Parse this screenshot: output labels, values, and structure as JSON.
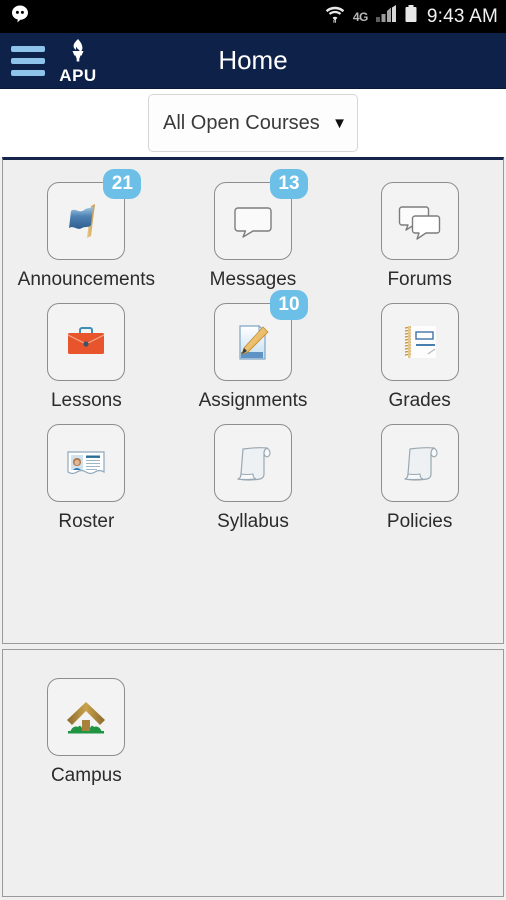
{
  "status_bar": {
    "notification_icon": "hangouts-icon",
    "wifi_icon": "wifi-icon",
    "network_label": "4G",
    "signal_icon": "signal-bars-icon",
    "battery_icon": "battery-icon",
    "time": "9:43 AM"
  },
  "header": {
    "menu_icon": "hamburger-menu-icon",
    "logo_icon": "apu-torch-icon",
    "logo_text": "APU",
    "title": "Home",
    "background_color": "#0e2149"
  },
  "filter": {
    "selected": "All Open Courses",
    "caret": "▼",
    "options": [
      "All Open Courses"
    ]
  },
  "panels": [
    {
      "name": "course-tools",
      "rows": [
        [
          {
            "id": "announcements",
            "label": "Announcements",
            "icon": "flag-icon",
            "badge": "21"
          },
          {
            "id": "messages",
            "label": "Messages",
            "icon": "speech-bubble-icon",
            "badge": "13"
          },
          {
            "id": "forums",
            "label": "Forums",
            "icon": "double-speech-bubble-icon",
            "badge": null
          }
        ],
        [
          {
            "id": "lessons",
            "label": "Lessons",
            "icon": "briefcase-icon",
            "badge": null
          },
          {
            "id": "assignments",
            "label": "Assignments",
            "icon": "document-pencil-icon",
            "badge": "10"
          },
          {
            "id": "grades",
            "label": "Grades",
            "icon": "notepad-icon",
            "badge": null
          }
        ],
        [
          {
            "id": "roster",
            "label": "Roster",
            "icon": "id-card-icon",
            "badge": null
          },
          {
            "id": "syllabus",
            "label": "Syllabus",
            "icon": "scroll-icon",
            "badge": null
          },
          {
            "id": "policies",
            "label": "Policies",
            "icon": "scroll-icon",
            "badge": null
          }
        ]
      ]
    },
    {
      "name": "site-tools",
      "rows": [
        [
          {
            "id": "campus",
            "label": "Campus",
            "icon": "house-icon",
            "badge": null
          }
        ]
      ]
    }
  ],
  "colors": {
    "header_navy": "#0e2149",
    "badge_blue": "#6cc0e8",
    "hamburger_blue": "#8ec4ea",
    "panel_gray": "#efefef",
    "accent_orange": "#e8552d"
  }
}
